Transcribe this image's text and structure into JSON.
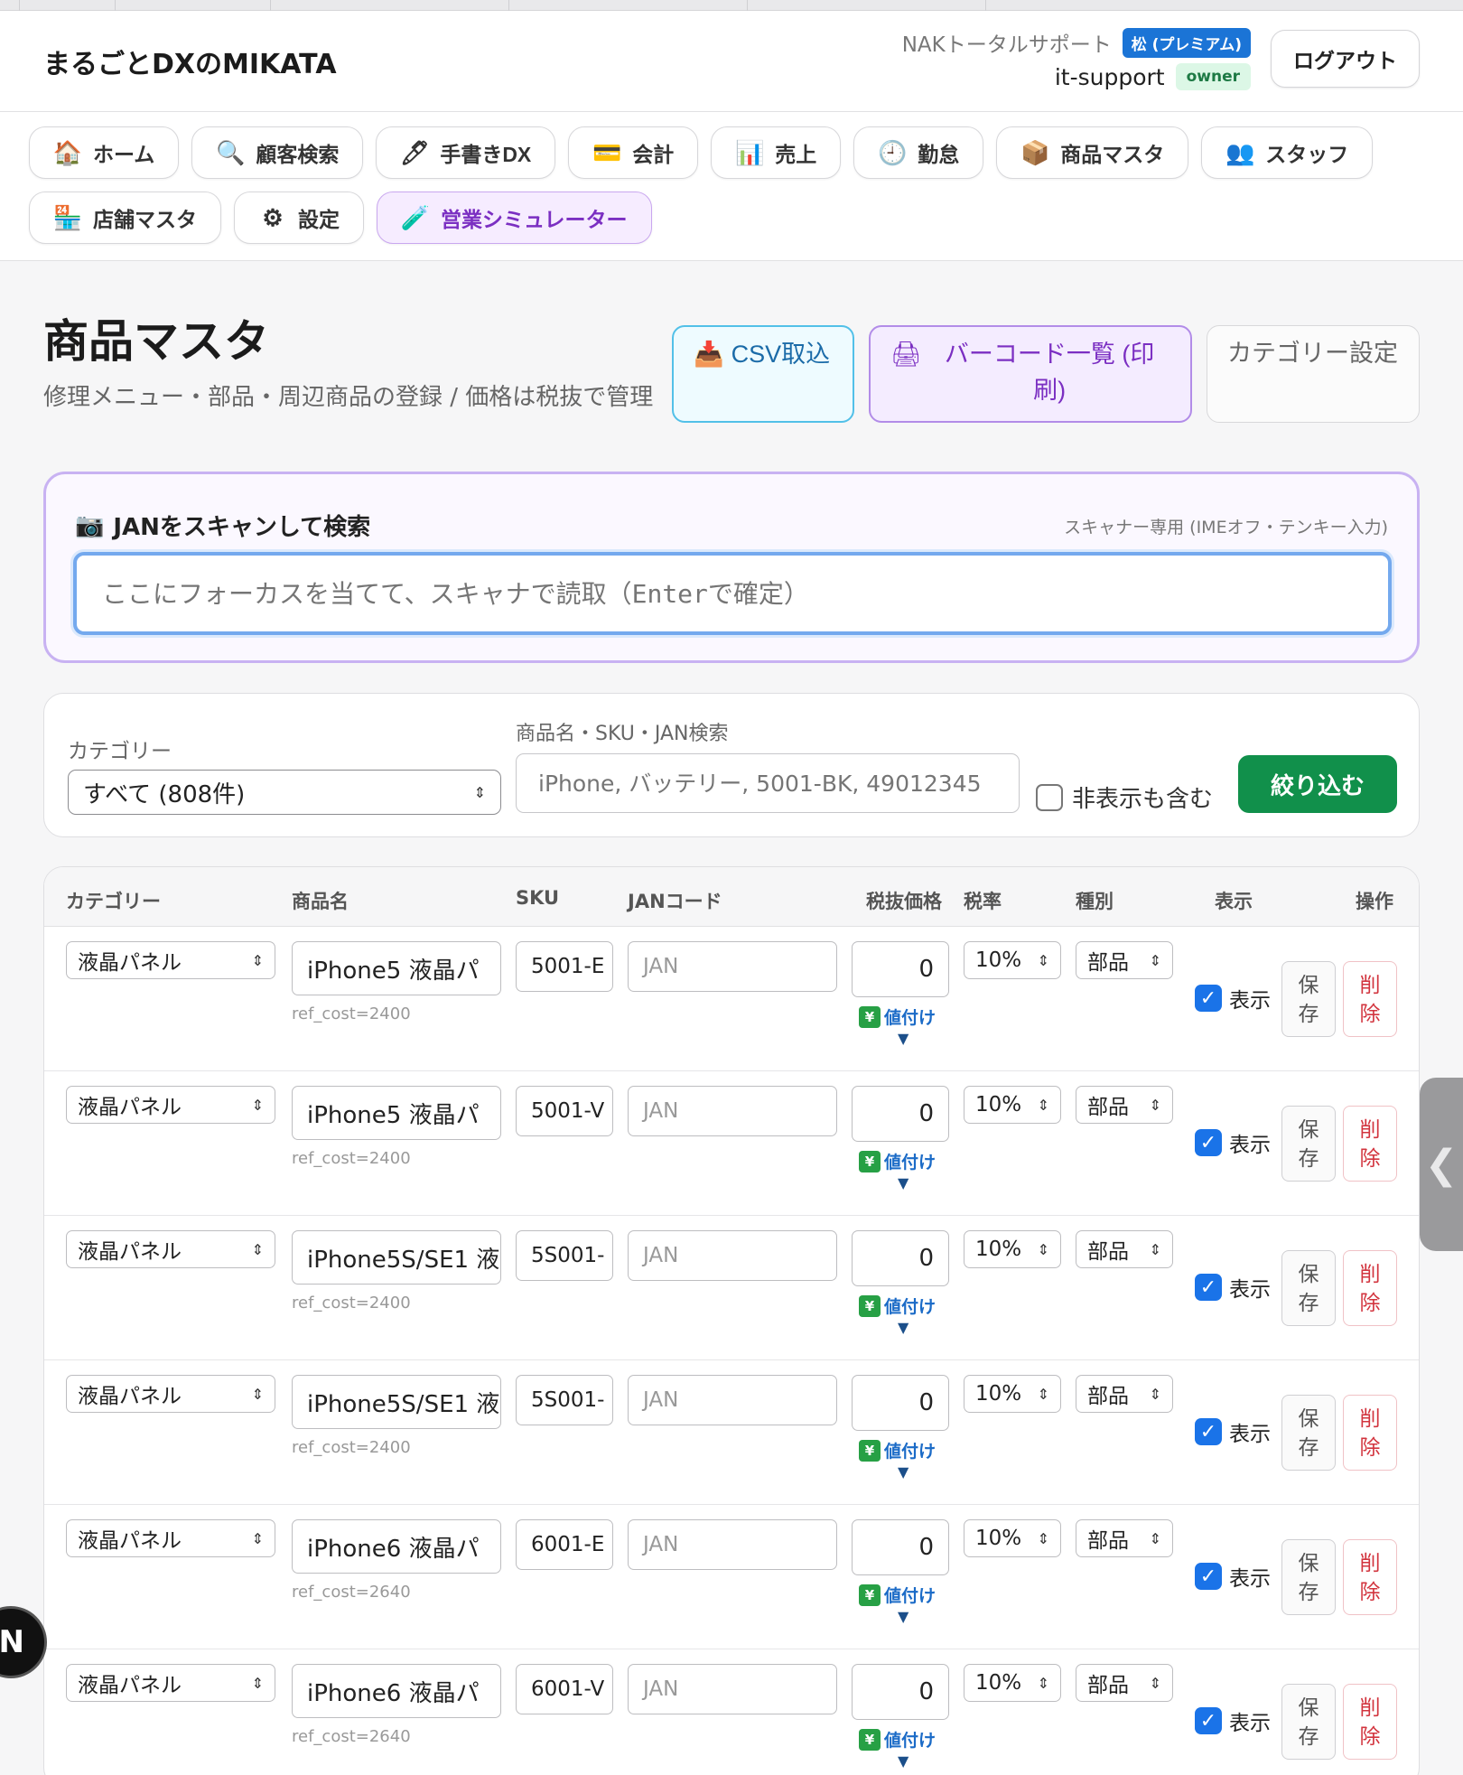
{
  "header": {
    "brand": "まるごとDXのMIKATA",
    "company": "NAKトータルサポート",
    "plan_badge": "松 (プレミアム)",
    "user": "it-support",
    "role_badge": "owner",
    "logout_label": "ログアウト"
  },
  "nav": [
    {
      "label": "ホーム",
      "icon": "🏠"
    },
    {
      "label": "顧客検索",
      "icon": "🔍"
    },
    {
      "label": "手書きDX",
      "icon": "🖊"
    },
    {
      "label": "会計",
      "icon": "💳"
    },
    {
      "label": "売上",
      "icon": "📊"
    },
    {
      "label": "勤怠",
      "icon": "🕘"
    },
    {
      "label": "商品マスタ",
      "icon": "📦"
    },
    {
      "label": "スタッフ",
      "icon": "👥"
    },
    {
      "label": "店舗マスタ",
      "icon": "🏪"
    },
    {
      "label": "設定",
      "icon": "⚙"
    },
    {
      "label": "営業シミュレーター",
      "icon": "🧪"
    }
  ],
  "page": {
    "title": "商品マスタ",
    "subtitle": "修理メニュー・部品・周辺商品の登録 / 価格は税抜で管理",
    "csv_label": "CSV取込",
    "barcode_label": "バーコード一覧 (印刷)",
    "category_label": "カテゴリー設定"
  },
  "scan": {
    "title": "JANをスキャンして検索",
    "hint": "スキャナー専用 (IMEオフ・テンキー入力)",
    "placeholder": "ここにフォーカスを当てて、スキャナで読取（Enterで確定）"
  },
  "filter": {
    "category_label": "カテゴリー",
    "category_value": "すべて (808件)",
    "search_label": "商品名・SKU・JAN検索",
    "search_placeholder": "iPhone, バッテリー, 5001-BK, 49012345",
    "include_hidden_label": "非表示も含む",
    "submit_label": "絞り込む"
  },
  "table": {
    "headers": {
      "category": "カテゴリー",
      "name": "商品名",
      "sku": "SKU",
      "jan": "JANコード",
      "price": "税抜価格",
      "tax": "税率",
      "type": "種別",
      "show": "表示",
      "ops": "操作"
    },
    "jan_placeholder": "JAN",
    "price_up_label": "値付け",
    "show_label": "表示",
    "save_label": "保存",
    "delete_label": "削除",
    "rows": [
      {
        "category": "液晶パネル",
        "name": "iPhone5 液晶パ",
        "ref": "ref_cost=2400",
        "sku": "5001-E",
        "price": "0",
        "tax": "10%",
        "type": "部品"
      },
      {
        "category": "液晶パネル",
        "name": "iPhone5 液晶パ",
        "ref": "ref_cost=2400",
        "sku": "5001-V",
        "price": "0",
        "tax": "10%",
        "type": "部品"
      },
      {
        "category": "液晶パネル",
        "name": "iPhone5S/SE1 液",
        "ref": "ref_cost=2400",
        "sku": "5S001-",
        "price": "0",
        "tax": "10%",
        "type": "部品"
      },
      {
        "category": "液晶パネル",
        "name": "iPhone5S/SE1 液",
        "ref": "ref_cost=2400",
        "sku": "5S001-",
        "price": "0",
        "tax": "10%",
        "type": "部品"
      },
      {
        "category": "液晶パネル",
        "name": "iPhone6 液晶パ",
        "ref": "ref_cost=2640",
        "sku": "6001-E",
        "price": "0",
        "tax": "10%",
        "type": "部品"
      },
      {
        "category": "液晶パネル",
        "name": "iPhone6 液晶パ",
        "ref": "ref_cost=2640",
        "sku": "6001-V",
        "price": "0",
        "tax": "10%",
        "type": "部品"
      }
    ]
  },
  "floating": {
    "side_tab_glyph": "❮",
    "badge_letter": "N"
  }
}
